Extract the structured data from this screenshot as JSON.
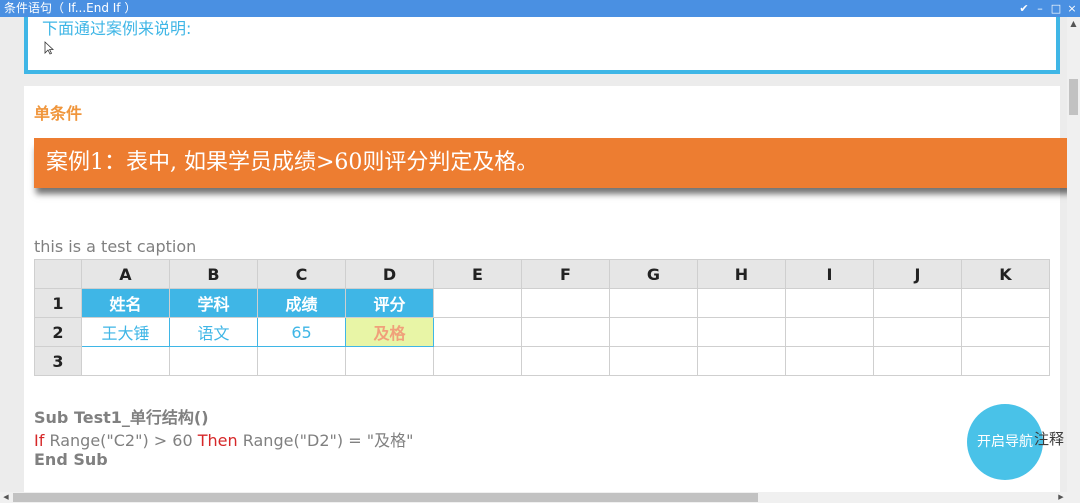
{
  "window": {
    "title": "条件语句（ If...End If ）",
    "controls": [
      "✔",
      "–",
      "□",
      "×"
    ]
  },
  "intro": {
    "text": "下面通过案例来说明:"
  },
  "section_title": "单条件",
  "banner": "案例1：表中, 如果学员成绩>60则评分判定及格。",
  "caption": "this is a test caption",
  "sheet": {
    "columns": [
      "A",
      "B",
      "C",
      "D",
      "E",
      "F",
      "G",
      "H",
      "I",
      "J",
      "K"
    ],
    "rows": [
      "1",
      "2",
      "3"
    ],
    "header_row": [
      "姓名",
      "学科",
      "成绩",
      "评分"
    ],
    "data_row": [
      "王大锤",
      "语文",
      "65",
      "及格"
    ]
  },
  "code": {
    "line1": "Sub Test1_单行结构()",
    "line2_kw_if": "If",
    "line2_mid": " Range(\"C2\") > 60 ",
    "line2_kw_then": "Then",
    "line2_end": " Range(\"D2\") = \"及格\"",
    "line3": "End Sub"
  },
  "nav_button": "开启导航",
  "note_label": "注释",
  "colors": {
    "titlebar": "#4a90e2",
    "accent_blue": "#3fb6e6",
    "banner_orange": "#ed7d31",
    "section_orange": "#f0963c",
    "pass_bg": "#e8f5a6",
    "keyword_red": "#d62728"
  }
}
